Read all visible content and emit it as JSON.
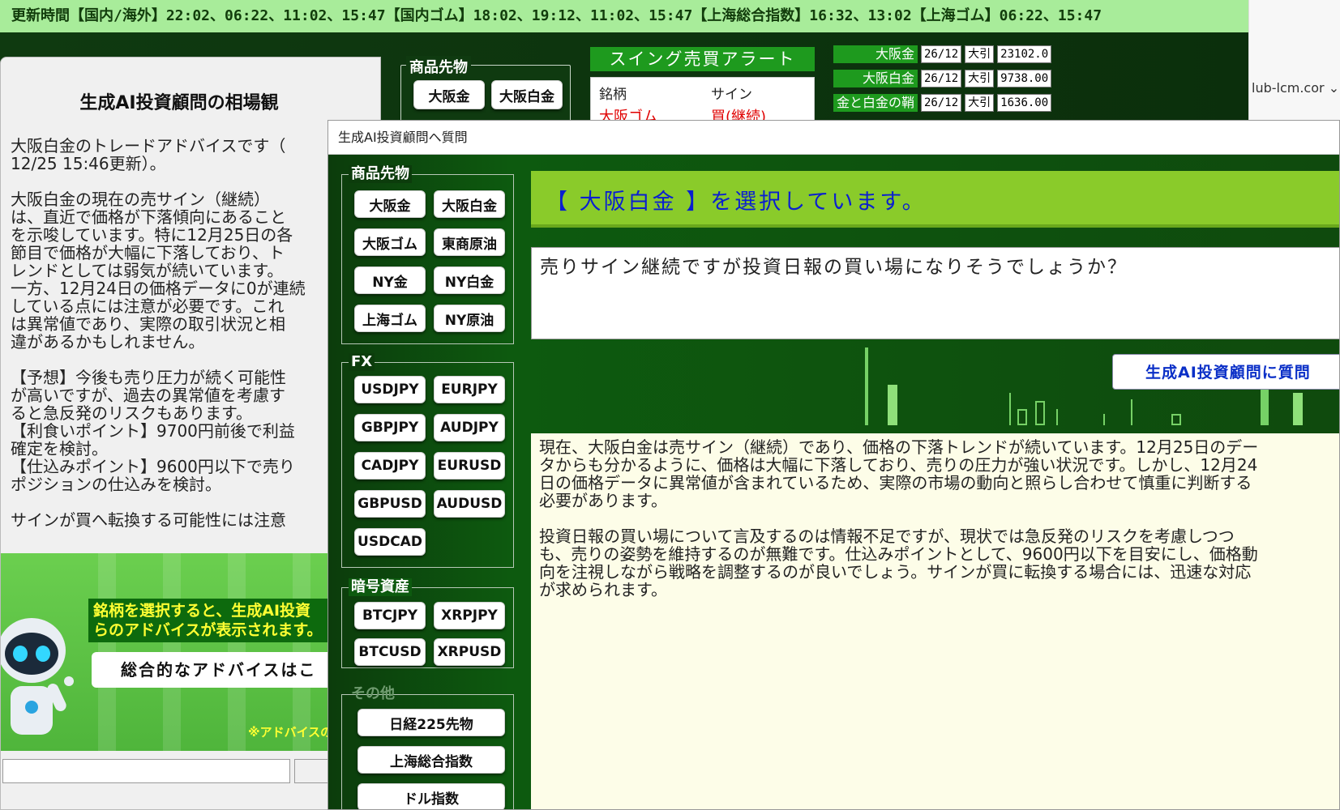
{
  "ticker": {
    "text": "更新時間【国内/海外】22:02、06:22、11:02、15:47【国内ゴム】18:02、19:12、11:02、15:47【上海総合指数】16:32、13:02【上海ゴム】06:22、15:47"
  },
  "browser": {
    "url_fragment": "lub-lcm.cor",
    "dropdown_glyph": "⌄"
  },
  "bg_panel": {
    "legend": "商品先物",
    "buttons": [
      "大阪金",
      "大阪白金"
    ],
    "swing": {
      "title": "スイング売買アラート",
      "col_name": "銘柄",
      "col_sign": "サイン",
      "row_name": "大阪ゴム",
      "row_sign": "買(継続)"
    },
    "prices": [
      {
        "name": "大阪金",
        "month": "26/12",
        "kind": "大引",
        "price": "23102.0"
      },
      {
        "name": "大阪白金",
        "month": "26/12",
        "kind": "大引",
        "price": "9738.00"
      },
      {
        "name": "金と白金の鞘",
        "month": "26/12",
        "kind": "大引",
        "price": "1636.00"
      }
    ]
  },
  "left_window": {
    "title": "生成AI投資顧問の相場観",
    "advice": "大阪白金のトレードアドバイスです（\n12/25 15:46更新）。\n\n大阪白金の現在の売サイン（継続）\nは、直近で価格が下落傾向にあること\nを示唆しています。特に12月25日の各\n節目で価格が大幅に下落しており、ト\nレンドとしては弱気が続いています。\n一方、12月24日の価格データに0が連続\nしている点には注意が必要です。これ\nは異常値であり、実際の取引状況と相\n違があるかもしれません。\n\n【予想】今後も売り圧力が続く可能性\nが高いですが、過去の異常値を考慮す\nると急反発のリスクもあります。\n【利食いポイント】9700円前後で利益\n確定を検討。\n【仕込みポイント】9600円以下で売り\nポジションの仕込みを検討。\n\nサインが買へ転換する可能性には注意",
    "banner_text": "銘柄を選択すると、生成AI投資\nらのアドバイスが表示されます。",
    "overall_button": "総合的なアドバイスはこ",
    "note": "※アドバイスの"
  },
  "dialog": {
    "title": "生成AI投資顧問へ質問",
    "sections": [
      {
        "title": "商品先物",
        "buttons": [
          "大阪金",
          "大阪白金",
          "大阪ゴム",
          "東商原油",
          "NY金",
          "NY白金",
          "上海ゴム",
          "NY原油"
        ]
      },
      {
        "title": "FX",
        "buttons": [
          "USDJPY",
          "EURJPY",
          "GBPJPY",
          "AUDJPY",
          "CADJPY",
          "EURUSD",
          "GBPUSD",
          "AUDUSD",
          "USDCAD"
        ]
      },
      {
        "title": "暗号資産",
        "buttons": [
          "BTCJPY",
          "XRPJPY",
          "BTCUSD",
          "XRPUSD"
        ]
      },
      {
        "title": "その他",
        "buttons": [
          "日経225先物",
          "上海総合指数",
          "ドル指数"
        ]
      }
    ],
    "selection": "【 大阪白金 】を選択しています。",
    "question": "売りサイン継続ですが投資日報の買い場になりそうでしょうか？",
    "ask_button": "生成AI投資顧問に質問",
    "answer": "現在、大阪白金は売サイン（継続）であり、価格の下落トレンドが続いています。12月25日のデー\nタからも分かるように、価格は大幅に下落しており、売りの圧力が強い状況です。しかし、12月24\n日の価格データに異常値が含まれているため、実際の市場の動向と照らし合わせて慎重に判断する\n必要があります。\n\n投資日報の買い場について言及するのは情報不足ですが、現状では急反発のリスクを考慮しつつ\nも、売りの姿勢を維持するのが無難です。仕込みポイントとして、9600円以下を目安にし、価格動\n向を注視しながら戦略を調整するのが良いでしょう。サインが買に転換する場合には、迅速な対応\nが求められます。"
  }
}
